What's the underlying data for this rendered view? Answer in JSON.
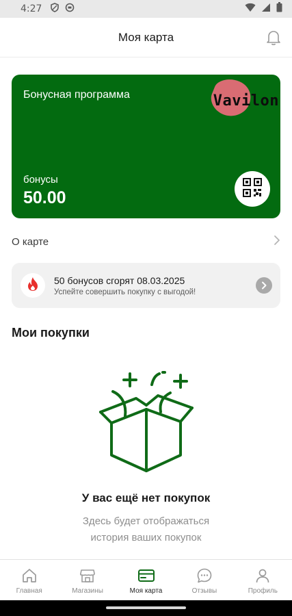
{
  "status_bar": {
    "time": "4:27",
    "icons_left": [
      "shield-icon",
      "circle-app-icon"
    ],
    "icons_right": [
      "wifi-icon",
      "signal-icon",
      "battery-icon"
    ]
  },
  "header": {
    "title": "Моя карта",
    "notification_icon": "bell-icon"
  },
  "card": {
    "program_title": "Бонусная программа",
    "logo_text": "Vavilon",
    "bonus_label": "бонусы",
    "bonus_value": "50.00",
    "qr_icon": "qr-code-icon",
    "colors": {
      "background": "#036b10",
      "logo_blob": "#d96c73"
    }
  },
  "about": {
    "label": "О карте",
    "chevron_icon": "chevron-right-icon"
  },
  "expiry": {
    "icon": "flame-icon",
    "title": "50 бонусов сгорят 08.03.2025",
    "subtitle": "Успейте совершить покупку с выгодой!",
    "arrow_icon": "arrow-right-icon",
    "colors": {
      "flame": "#e8302d"
    }
  },
  "purchases": {
    "section_title": "Мои покупки",
    "illustration": "empty-box-icon",
    "empty_title": "У вас ещё нет покупок",
    "empty_description_line1": "Здесь будет отображаться",
    "empty_description_line2": "история ваших покупок",
    "colors": {
      "illustration": "#0f6b17"
    }
  },
  "tab_bar": {
    "tabs": [
      {
        "label": "Главная",
        "icon": "home-icon",
        "active": false
      },
      {
        "label": "Магазины",
        "icon": "store-icon",
        "active": false
      },
      {
        "label": "Моя карта",
        "icon": "card-icon",
        "active": true
      },
      {
        "label": "Отзывы",
        "icon": "chat-bubble-icon",
        "active": false
      },
      {
        "label": "Профиль",
        "icon": "profile-icon",
        "active": false
      }
    ],
    "colors": {
      "active": "#0f6b17",
      "inactive": "#8a8a8a"
    }
  }
}
